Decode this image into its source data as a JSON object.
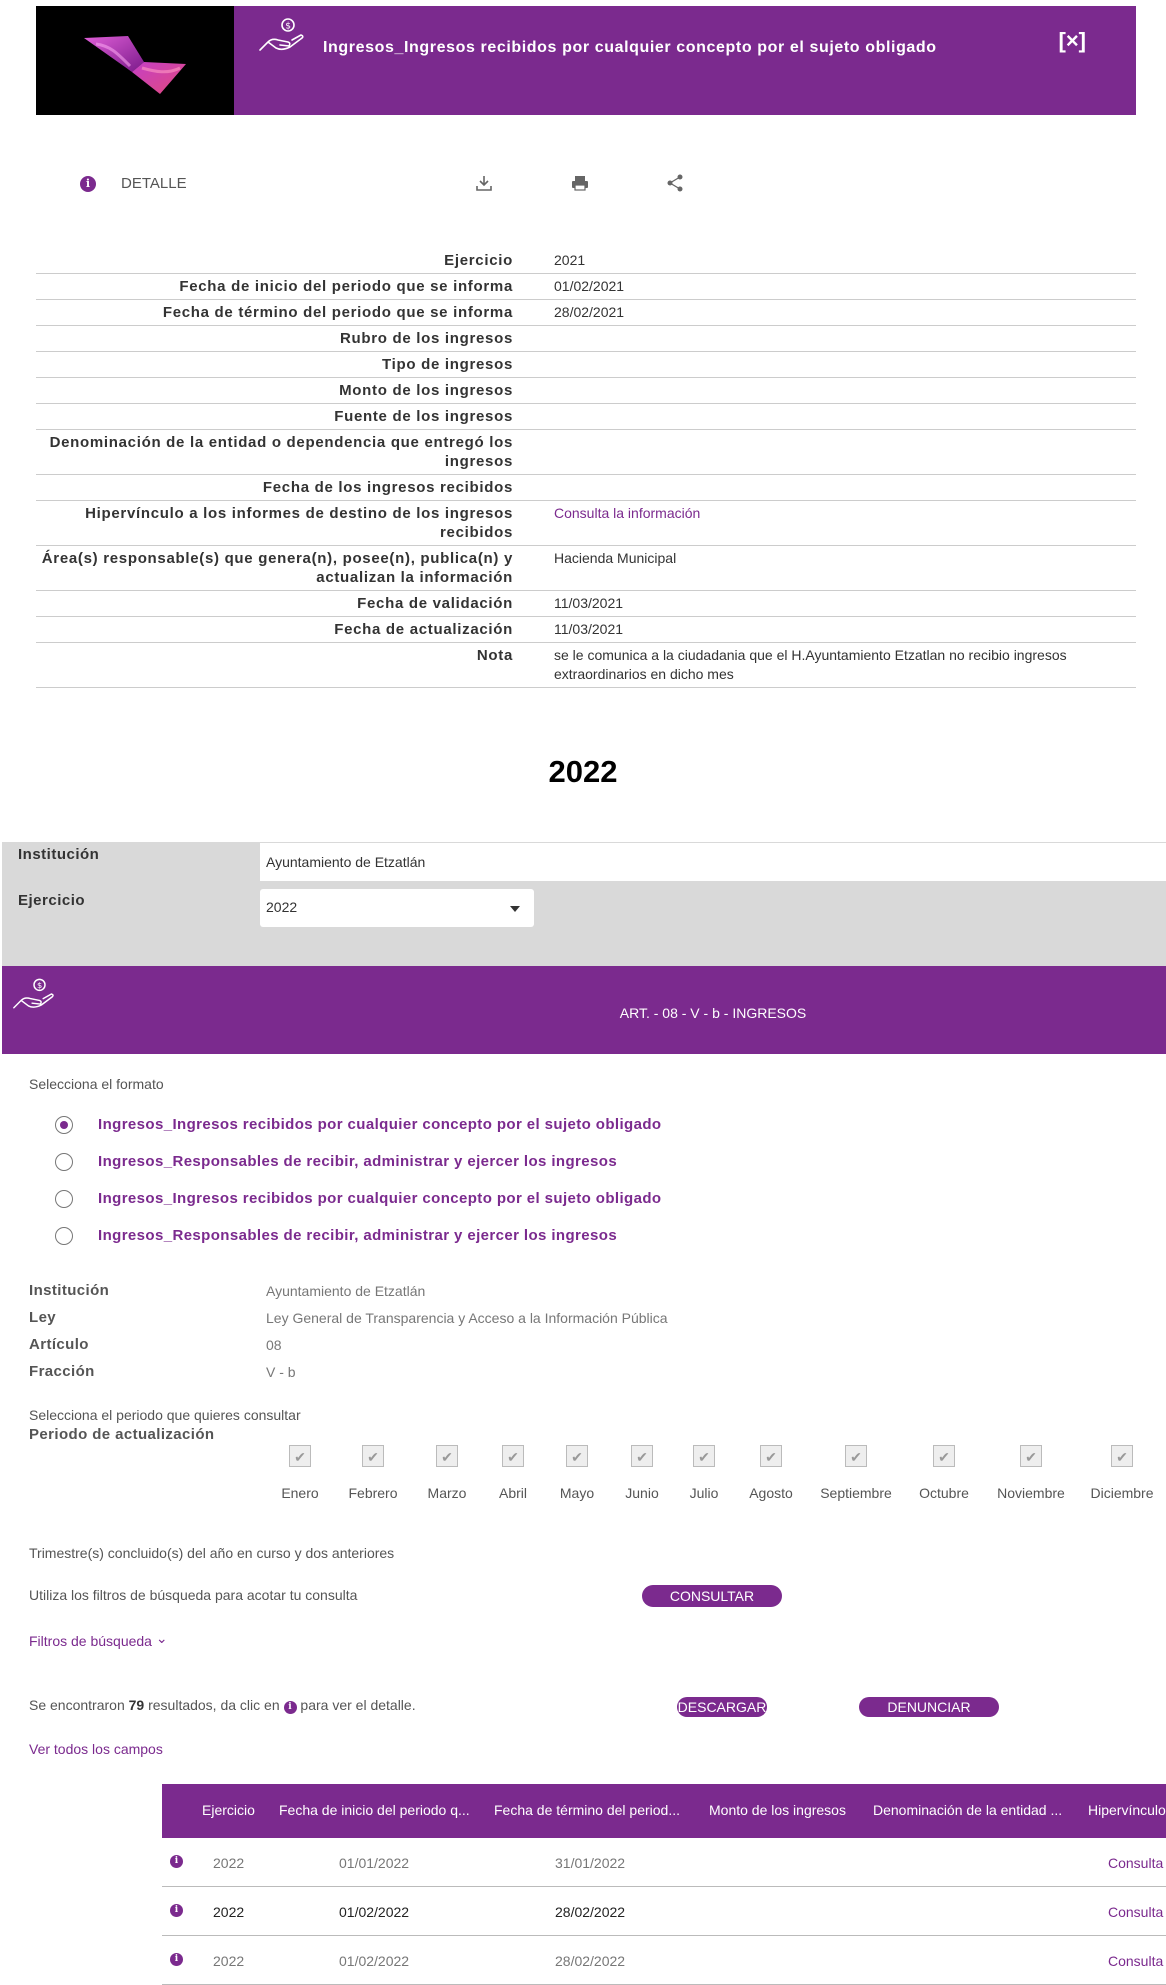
{
  "detail_header": {
    "title": "Ingresos_Ingresos recibidos por cualquier concepto por el sujeto obligado",
    "close_label": "[×]"
  },
  "toolbar": {
    "detail_label": "DETALLE",
    "icons": [
      "download-icon",
      "print-icon",
      "share-icon"
    ]
  },
  "detail_rows": [
    {
      "key": "Ejercicio",
      "value": "2021"
    },
    {
      "key": "Fecha de inicio del periodo que se informa",
      "value": "01/02/2021"
    },
    {
      "key": "Fecha de término del periodo que se informa",
      "value": "28/02/2021"
    },
    {
      "key": "Rubro de los ingresos",
      "value": ""
    },
    {
      "key": "Tipo de ingresos",
      "value": ""
    },
    {
      "key": "Monto de los ingresos",
      "value": ""
    },
    {
      "key": "Fuente de los ingresos",
      "value": ""
    },
    {
      "key": "Denominación de la entidad o dependencia que entregó los ingresos",
      "value": ""
    },
    {
      "key": "Fecha de los ingresos recibidos",
      "value": ""
    },
    {
      "key": "Hipervínculo a los informes de destino de los ingresos recibidos",
      "value": "Consulta la información"
    },
    {
      "key": "Área(s) responsable(s) que genera(n), posee(n), publica(n) y actualizan la información",
      "value": "Hacienda Municipal"
    },
    {
      "key": "Fecha de validación",
      "value": "11/03/2021"
    },
    {
      "key": "Fecha de actualización",
      "value": "11/03/2021"
    },
    {
      "key": "Nota",
      "value": "se le comunica a la ciudadania que el H.Ayuntamiento Etzatlan no recibio ingresos extraordinarios en dicho mes"
    }
  ],
  "year_heading": "2022",
  "filters": {
    "institucion_label": "Institución",
    "institucion_value": "Ayuntamiento de Etzatlán",
    "ejercicio_label": "Ejercicio",
    "ejercicio_value": "2022"
  },
  "art_banner": {
    "title": "ART. - 08 - V - b - INGRESOS"
  },
  "formats": {
    "label": "Selecciona el formato",
    "options": [
      {
        "label": "Ingresos_Ingresos recibidos por cualquier concepto por el sujeto obligado",
        "selected": true
      },
      {
        "label": "Ingresos_Responsables de recibir, administrar y ejercer los ingresos",
        "selected": false
      },
      {
        "label": "Ingresos_Ingresos recibidos por cualquier concepto por el sujeto obligado",
        "selected": false
      },
      {
        "label": "Ingresos_Responsables de recibir, administrar y ejercer los ingresos",
        "selected": false
      }
    ]
  },
  "meta": [
    {
      "key": "Institución",
      "value": "Ayuntamiento de Etzatlán"
    },
    {
      "key": "Ley",
      "value": "Ley General de Transparencia y Acceso a la Información Pública"
    },
    {
      "key": "Artículo",
      "value": "08"
    },
    {
      "key": "Fracción",
      "value": "V - b"
    }
  ],
  "period": {
    "prompt": "Selecciona el periodo que quieres consultar",
    "label": "Periodo de actualización",
    "check_glyph": "✔",
    "months": [
      "Enero",
      "Febrero",
      "Marzo",
      "Abril",
      "Mayo",
      "Junio",
      "Julio",
      "Agosto",
      "Septiembre",
      "Octubre",
      "Noviembre",
      "Diciembre"
    ],
    "note": "Trimestre(s) concluido(s) del año en curso y dos anteriores"
  },
  "search": {
    "hint": "Utiliza los filtros de búsqueda para acotar tu consulta",
    "consult_button": "CONSULTAR",
    "filters_link": "Filtros de búsqueda",
    "filters_chevron": "⌄"
  },
  "results": {
    "prefix": "Se encontraron",
    "count": "79",
    "suffix_a": "resultados, da clic en",
    "suffix_b": "para ver el detalle.",
    "download_button": "DESCARGAR",
    "report_button": "DENUNCIAR",
    "all_fields_link": "Ver todos los campos"
  },
  "table": {
    "headers": [
      "Ejercicio",
      "Fecha de inicio del periodo q...",
      "Fecha de término del period...",
      "Monto de los ingresos",
      "Denominación de la entidad ...",
      "Hipervínculo"
    ],
    "rows": [
      {
        "ejercicio": "2022",
        "inicio": "01/01/2022",
        "termino": "31/01/2022",
        "link": "Consulta",
        "dim": true
      },
      {
        "ejercicio": "2022",
        "inicio": "01/02/2022",
        "termino": "28/02/2022",
        "link": "Consulta",
        "dim": false
      },
      {
        "ejercicio": "2022",
        "inicio": "01/02/2022",
        "termino": "28/02/2022",
        "link": "Consulta",
        "dim": true
      }
    ]
  },
  "colors": {
    "accent": "#7b2a8e",
    "filter_bg": "#d9d9d9"
  }
}
